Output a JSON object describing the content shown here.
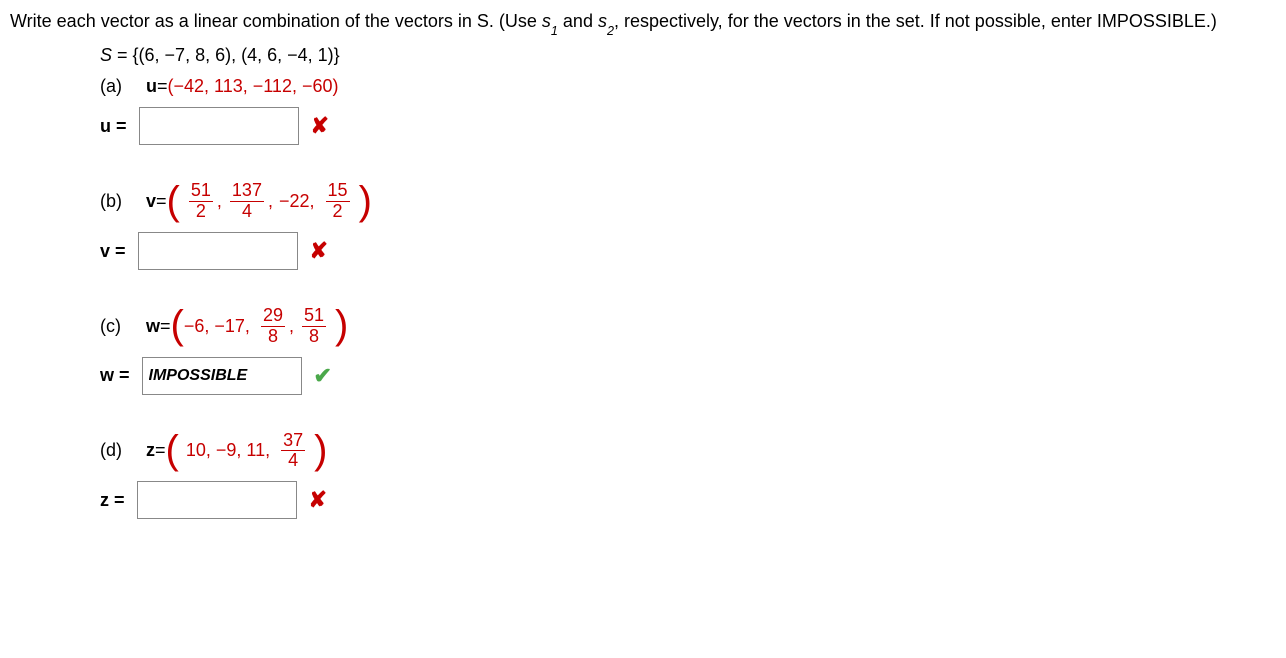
{
  "intro": {
    "text1": "Write each vector as a linear combination of the vectors in S. (Use ",
    "s1": "s",
    "s1sub": "1",
    "text2": " and ",
    "s2": "s",
    "s2sub": "2",
    "text3": ",  respectively, for the vectors in the set. If not possible, enter IMPOSSIBLE.)"
  },
  "set": {
    "lhs": "S",
    "eq": " = ",
    "rhs": "{(6, −7, 8, 6), (4, 6, −4, 1)}"
  },
  "parts": {
    "a": {
      "label": "(a)",
      "vec": "u",
      "eq": " = ",
      "target": "(−42, 113, −112, −60)",
      "ans_label": "u =",
      "input_value": "",
      "mark": "✘",
      "mark_type": "wrong"
    },
    "b": {
      "label": "(b)",
      "vec": "v",
      "eq": " = ",
      "f1": {
        "num": "51",
        "den": "2"
      },
      "f2": {
        "num": "137",
        "den": "4"
      },
      "t3": " −22,",
      "f4": {
        "num": "15",
        "den": "2"
      },
      "ans_label": "v =",
      "input_value": "",
      "mark": "✘",
      "mark_type": "wrong"
    },
    "c": {
      "label": "(c)",
      "vec": "w",
      "eq": " = ",
      "t1": "−6, −17,",
      "f2": {
        "num": "29",
        "den": "8"
      },
      "f3": {
        "num": "51",
        "den": "8"
      },
      "ans_label": "w =",
      "input_value": "IMPOSSIBLE",
      "mark": "✔",
      "mark_type": "correct"
    },
    "d": {
      "label": "(d)",
      "vec": "z",
      "eq": " = ",
      "t1": "10, −9, 11,",
      "f2": {
        "num": "37",
        "den": "4"
      },
      "ans_label": "z =",
      "input_value": "",
      "mark": "✘",
      "mark_type": "wrong"
    }
  }
}
